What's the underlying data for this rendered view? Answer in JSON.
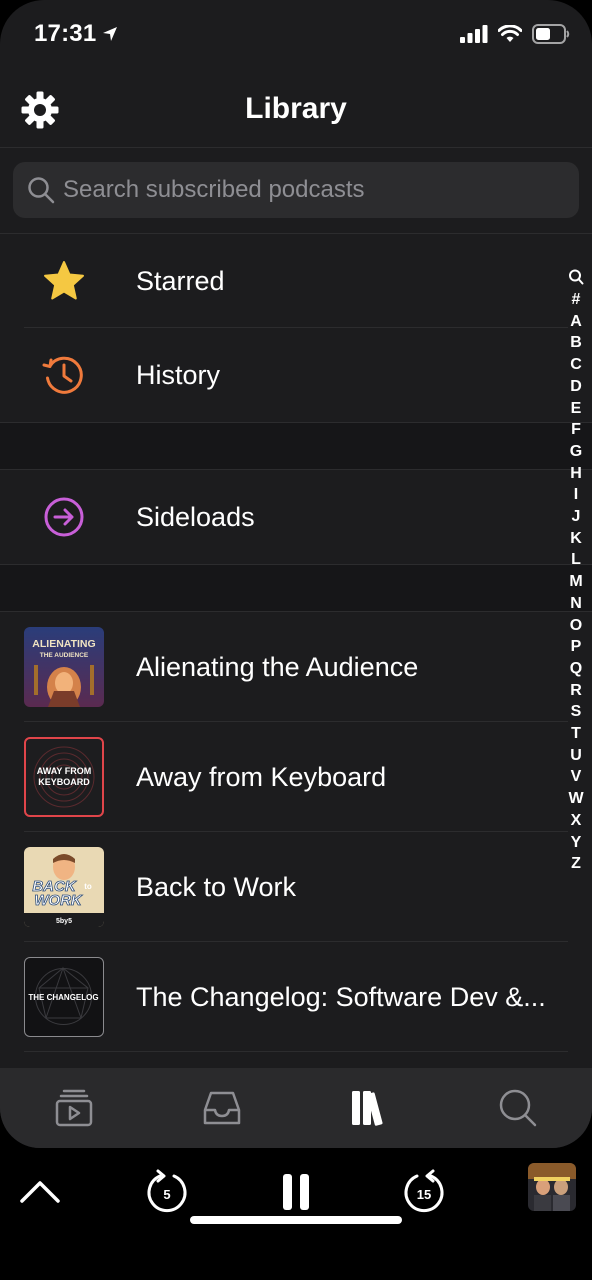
{
  "status_bar": {
    "time": "17:31"
  },
  "header": {
    "title": "Library"
  },
  "search": {
    "placeholder": "Search subscribed podcasts"
  },
  "rows": {
    "starred": "Starred",
    "history": "History",
    "sideloads": "Sideloads"
  },
  "podcasts": [
    {
      "title": "Alienating the Audience",
      "art_text_1": "ALIENATING",
      "art_text_2": "THE AUDIENCE"
    },
    {
      "title": "Away from Keyboard",
      "art_text_1": "AWAY FROM",
      "art_text_2": "KEYBOARD"
    },
    {
      "title": "Back to Work",
      "art_text_1": "BACK",
      "art_text_2": "WORK",
      "art_text_3": "to",
      "art_text_4": "5by5"
    },
    {
      "title": "The Changelog: Software Dev &...",
      "art_text_1": "THE CHANGELOG"
    }
  ],
  "index_letters": [
    "Q",
    "#",
    "A",
    "B",
    "C",
    "D",
    "E",
    "F",
    "G",
    "H",
    "I",
    "J",
    "K",
    "L",
    "M",
    "N",
    "O",
    "P",
    "Q",
    "R",
    "S",
    "T",
    "U",
    "V",
    "W",
    "X",
    "Y",
    "Z"
  ],
  "index_search_glyph": "search-icon",
  "tabs": [
    {
      "name": "now-playing-tab",
      "icon": "play-stack-icon"
    },
    {
      "name": "inbox-tab",
      "icon": "inbox-icon"
    },
    {
      "name": "library-tab",
      "icon": "library-icon",
      "active": true
    },
    {
      "name": "search-tab",
      "icon": "search-icon"
    }
  ],
  "player": {
    "skip_back": "5",
    "skip_forward": "15"
  },
  "colors": {
    "background": "#1c1c1e",
    "star": "#f5c842",
    "history": "#f07a3c",
    "sideloads": "#c85fd8"
  }
}
